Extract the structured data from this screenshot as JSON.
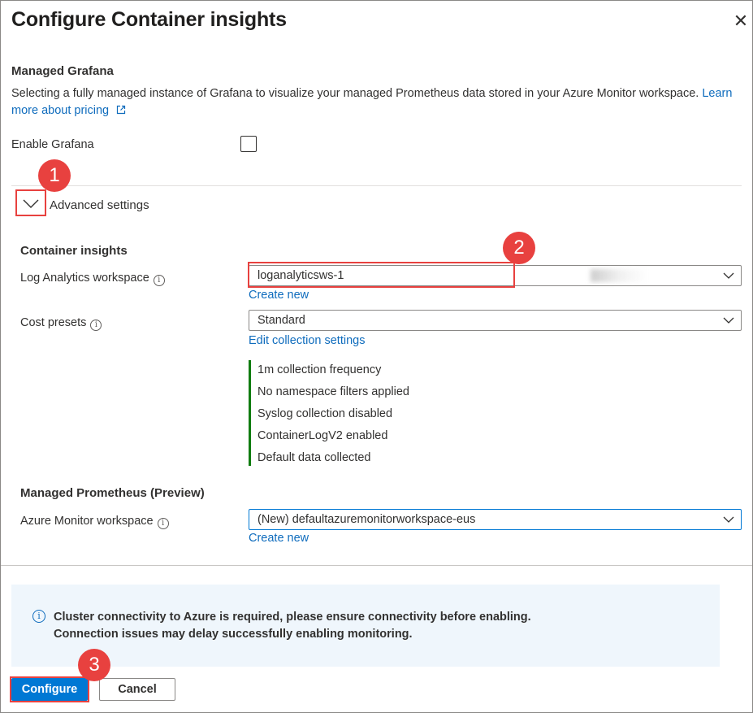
{
  "dialog": {
    "title": "Configure Container insights",
    "close_glyph": "✕"
  },
  "grafana": {
    "heading": "Managed Grafana",
    "description": "Selecting a fully managed instance of Grafana to visualize your managed Prometheus data stored in your Azure Monitor workspace.",
    "learn_link_line1": "Learn",
    "learn_link_line2": "more about pricing",
    "enable_label": "Enable Grafana",
    "enable_checked": false
  },
  "advanced": {
    "label": "Advanced settings",
    "expanded": true
  },
  "container_insights": {
    "heading": "Container insights",
    "log_analytics_label": "Log Analytics workspace",
    "log_analytics_value": "loganalyticsws-1",
    "create_new_1": "Create new",
    "cost_presets_label": "Cost presets",
    "cost_presets_value": "Standard",
    "edit_collection_link": "Edit collection settings",
    "summary": [
      "1m collection frequency",
      "No namespace filters applied",
      "Syslog collection disabled",
      "ContainerLogV2 enabled",
      "Default data collected"
    ]
  },
  "prometheus": {
    "heading": "Managed Prometheus (Preview)",
    "workspace_label": "Azure Monitor workspace",
    "workspace_value": "(New) defaultazuremonitorworkspace-eus",
    "create_new_2": "Create new"
  },
  "banner": {
    "line1": "Cluster connectivity to Azure is required, please ensure connectivity before enabling.",
    "line2": "Connection issues may delay successfully enabling monitoring."
  },
  "footer": {
    "configure_label": "Configure",
    "cancel_label": "Cancel"
  },
  "markers": [
    "1",
    "2",
    "3"
  ],
  "colors": {
    "accent": "#0078d4",
    "link": "#0f6cbd",
    "marker": "#e8413f",
    "summary_bar": "#107c10",
    "banner_bg": "#eff6fc"
  }
}
